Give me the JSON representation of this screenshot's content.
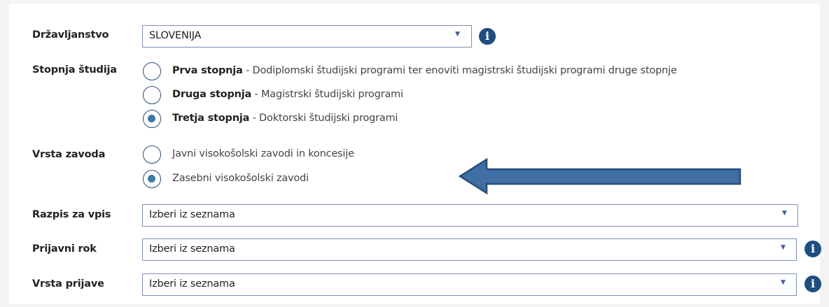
{
  "citizenship": {
    "label": "Državljanstvo",
    "value": "SLOVENIJA",
    "info_icon": "info-icon"
  },
  "study_level": {
    "label": "Stopnja študija",
    "options": [
      {
        "title": "Prva stopnja",
        "description": " - Dodiplomski študijski programi ter enoviti magistrski študijski programi druge stopnje",
        "selected": false
      },
      {
        "title": "Druga stopnja",
        "description": " - Magistrski študijski programi",
        "selected": false
      },
      {
        "title": "Tretja stopnja",
        "description": " - Doktorski študijski programi",
        "selected": true
      }
    ]
  },
  "institution_type": {
    "label": "Vrsta zavoda",
    "options": [
      {
        "text": "Javni visokošolski zavodi in koncesije",
        "selected": false
      },
      {
        "text": "Zasebni visokošolski zavodi",
        "selected": true
      }
    ]
  },
  "call_for_enrollment": {
    "label": "Razpis za vpis",
    "value": "Izberi iz seznama"
  },
  "application_deadline": {
    "label": "Prijavni rok",
    "value": "Izberi iz seznama",
    "info_icon": "info-icon"
  },
  "application_type": {
    "label": "Vrsta prijave",
    "value": "Izberi iz seznama",
    "info_icon": "info-icon"
  },
  "colors": {
    "select_border": "#7d8fb0",
    "info_bg": "#1f4e80",
    "radio_border": "#2c4d76",
    "radio_dot": "#3a7aa3",
    "arrow_fill": "#3f6fa5",
    "arrow_stroke": "#2a4c78"
  },
  "icons": {
    "dropdown": "▼",
    "info": "i"
  }
}
